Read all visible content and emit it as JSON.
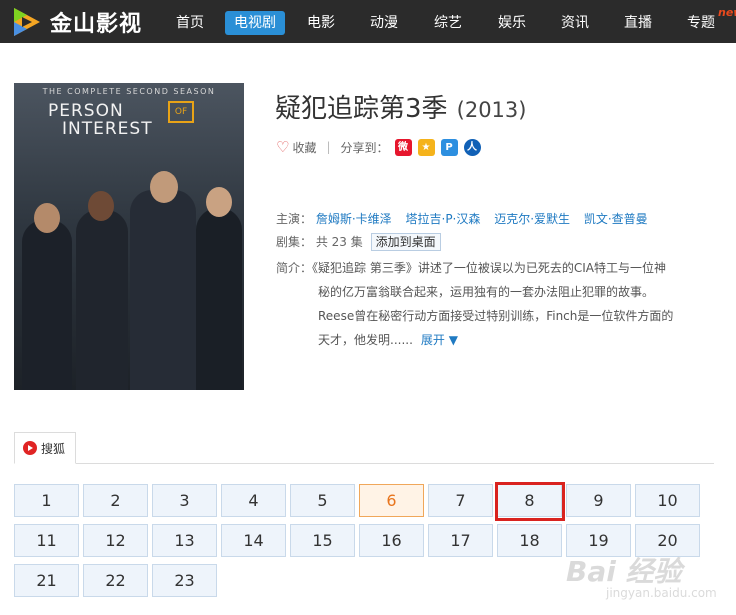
{
  "app": {
    "logo_text": "金山影视"
  },
  "nav": {
    "items": [
      {
        "label": "首页"
      },
      {
        "label": "电视剧",
        "active": true
      },
      {
        "label": "电影"
      },
      {
        "label": "动漫"
      },
      {
        "label": "综艺"
      },
      {
        "label": "娱乐"
      },
      {
        "label": "资讯"
      },
      {
        "label": "直播"
      },
      {
        "label": "专题"
      }
    ],
    "new_tag": "new"
  },
  "poster": {
    "season_text": "THE COMPLETE SECOND SEASON",
    "title_line1": "PERSON",
    "of_text": "OF",
    "title_line2": "INTEREST"
  },
  "show": {
    "title": "疑犯追踪第3季",
    "year": "(2013)",
    "favorite_label": "收藏",
    "share_label": "分享到：",
    "share_icons": [
      "weibo-icon",
      "qzone-icon",
      "pengyou-icon",
      "renren-icon"
    ],
    "cast_label": "主演：",
    "cast": [
      "詹姆斯·卡维泽",
      "塔拉吉·P·汉森",
      "迈克尔·爱默生",
      "凯文·查普曼"
    ],
    "episodes_label": "剧集：",
    "episodes_count_text": "共 23 集",
    "add_desktop_label": "添加到桌面",
    "desc_label": "简介：",
    "desc_lines": [
      "《疑犯追踪 第三季》讲述了一位被误以为已死去的CIA特工与一位神",
      "秘的亿万富翁联合起来，运用独有的一套办法阻止犯罪的故事。",
      "Reese曾在秘密行动方面接受过特别训练，Finch是一位软件方面的",
      "天才，他发明......"
    ],
    "expand_label": "展开 ▼"
  },
  "source": {
    "tab_label": "搜狐"
  },
  "episodes": {
    "items": [
      "1",
      "2",
      "3",
      "4",
      "5",
      "6",
      "7",
      "8",
      "9",
      "10",
      "11",
      "12",
      "13",
      "14",
      "15",
      "16",
      "17",
      "18",
      "19",
      "20",
      "21",
      "22",
      "23"
    ],
    "current": "6",
    "highlighted": "8"
  },
  "watermark": {
    "text": "Bai 经验",
    "sub": "jingyan.baidu.com"
  },
  "colors": {
    "accent": "#2a8fd6",
    "link": "#1f7ac2",
    "current_ep": "#e8741c",
    "highlight": "#d9231f",
    "topbar": "#2b2b2b"
  }
}
